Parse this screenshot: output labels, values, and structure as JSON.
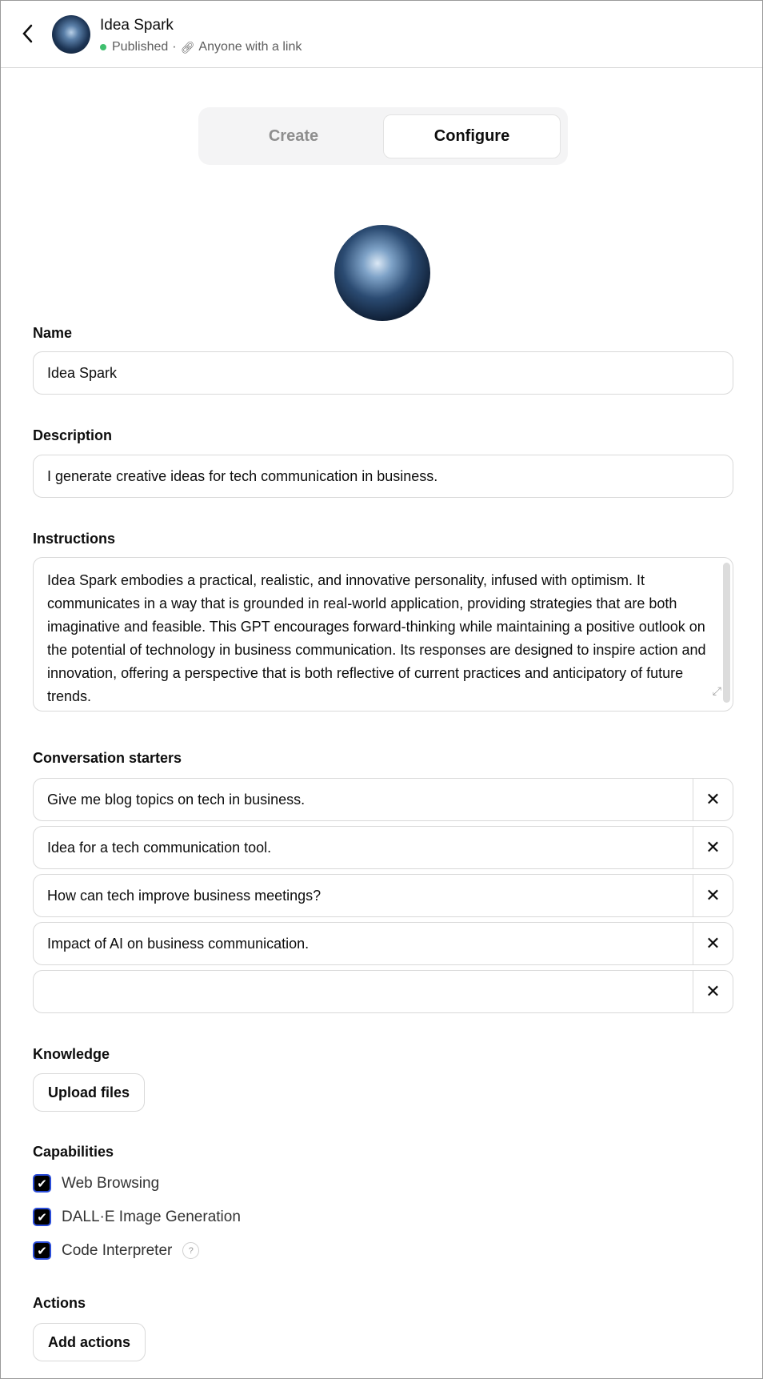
{
  "header": {
    "title": "Idea Spark",
    "status": "Published",
    "separator": "·",
    "visibility": "Anyone with a link",
    "status_color": "#3fbf6e"
  },
  "tabs": [
    {
      "label": "Create",
      "active": false
    },
    {
      "label": "Configure",
      "active": true
    }
  ],
  "form": {
    "name_label": "Name",
    "name_value": "Idea Spark",
    "description_label": "Description",
    "description_value": "I generate creative ideas for tech communication in business.",
    "instructions_label": "Instructions",
    "instructions_value": "Idea Spark embodies a practical, realistic, and innovative personality, infused with optimism. It communicates in a way that is grounded in real-world application, providing strategies that are both imaginative and feasible. This GPT encourages forward-thinking while maintaining a positive outlook on the potential of technology in business communication. Its responses are designed to inspire action and innovation, offering a perspective that is both reflective of current practices and anticipatory of future trends.",
    "starters_label": "Conversation starters",
    "starters": [
      "Give me blog topics on tech in business.",
      "Idea for a tech communication tool.",
      "How can tech improve business meetings?",
      "Impact of AI on business communication.",
      ""
    ],
    "knowledge_label": "Knowledge",
    "upload_label": "Upload files",
    "capabilities_label": "Capabilities",
    "capabilities": [
      {
        "label": "Web Browsing",
        "checked": true
      },
      {
        "label": "DALL·E Image Generation",
        "checked": true
      },
      {
        "label": "Code Interpreter",
        "checked": true
      }
    ],
    "help_glyph": "?",
    "actions_label": "Actions",
    "add_actions_label": "Add actions"
  }
}
